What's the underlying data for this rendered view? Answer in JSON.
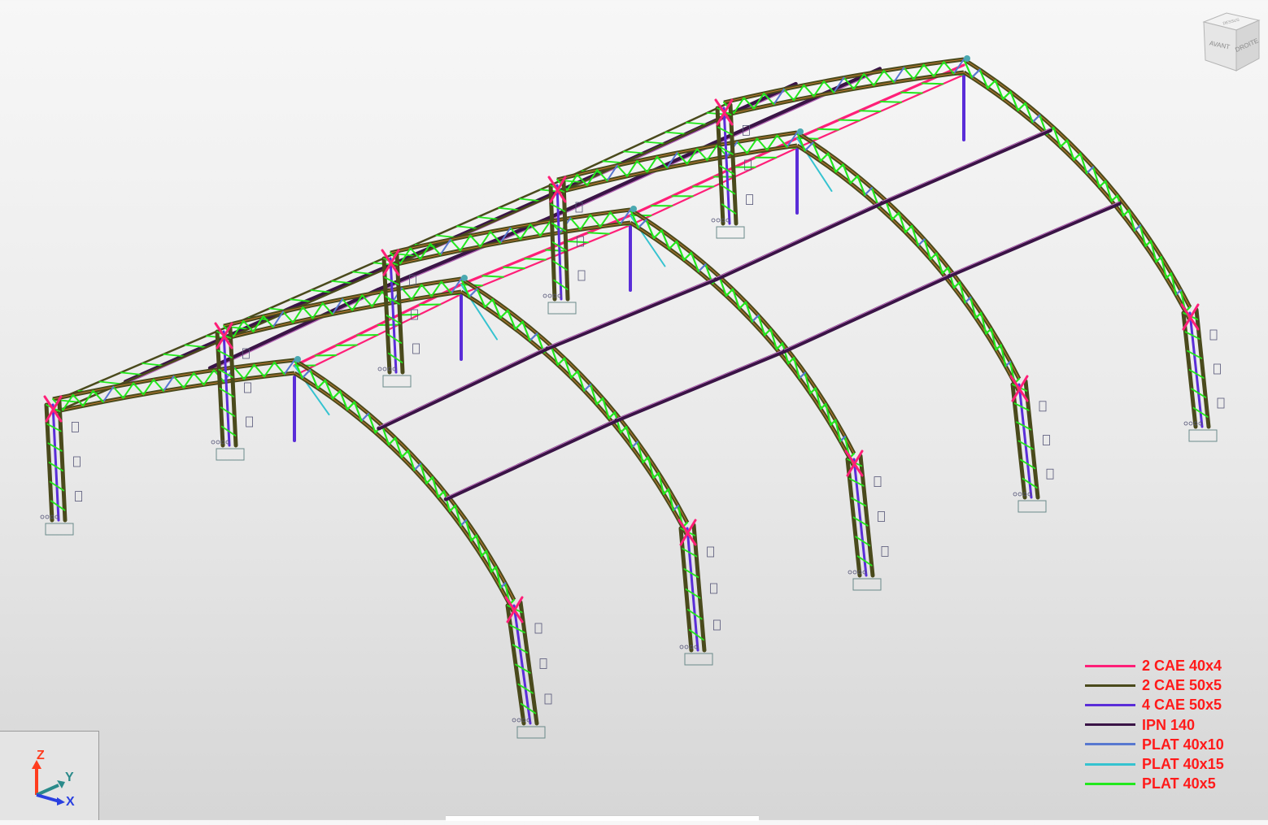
{
  "viewcube": {
    "top_label": "DESSUS",
    "front_label": "AVANT",
    "right_label": "DROITE"
  },
  "legend": {
    "items": [
      {
        "label": "2 CAE 40x4",
        "color": "#ff1f78"
      },
      {
        "label": "2 CAE 50x5",
        "color": "#4a4a1c"
      },
      {
        "label": "4 CAE 50x5",
        "color": "#5a2dd8"
      },
      {
        "label": "IPN 140",
        "color": "#3a1446"
      },
      {
        "label": "PLAT 40x10",
        "color": "#5878d0"
      },
      {
        "label": "PLAT 40x15",
        "color": "#35c3d0"
      },
      {
        "label": "PLAT 40x5",
        "color": "#22e81c"
      }
    ]
  },
  "axes": {
    "z": "Z",
    "y": "Y",
    "x": "X",
    "z_color": "#ff3c1e",
    "y_color": "#2a8a8a",
    "x_color": "#2a40e0"
  }
}
